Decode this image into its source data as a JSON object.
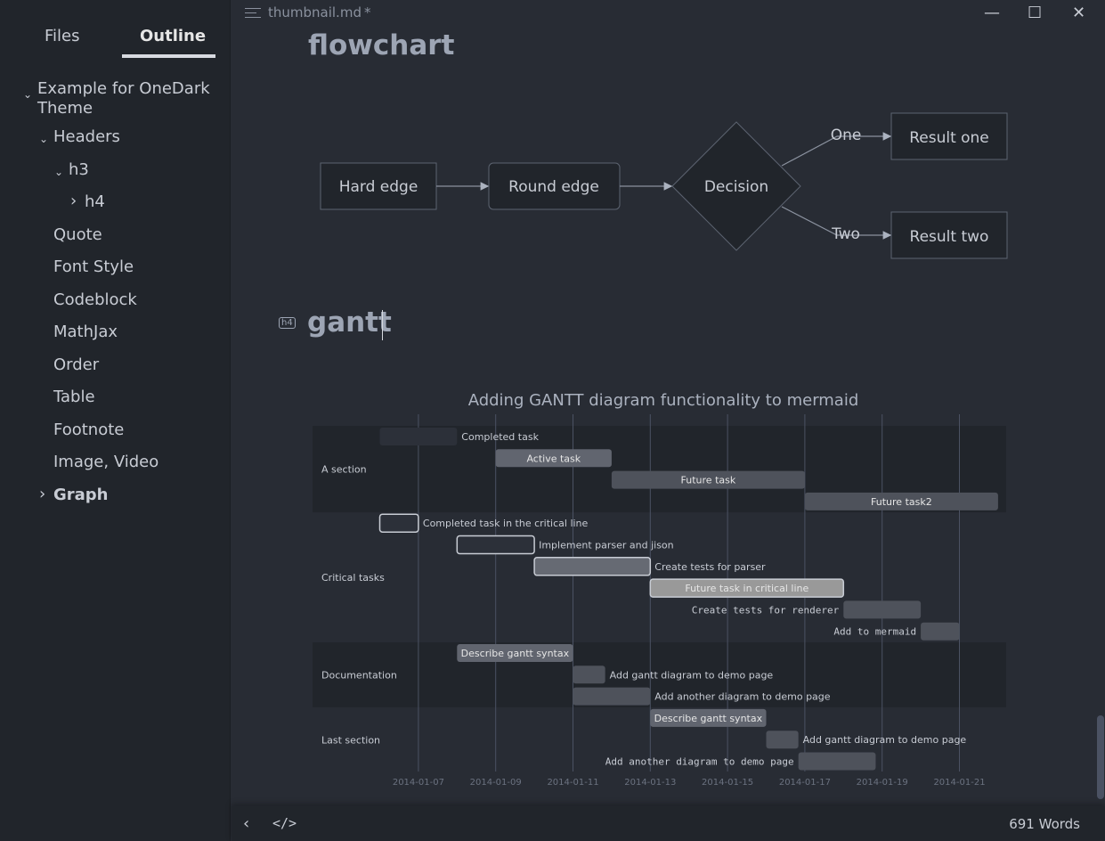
{
  "sidebar": {
    "tabs": [
      "Files",
      "Outline"
    ],
    "active_tab": "Outline",
    "outline": [
      {
        "label": "Example for OneDark Theme",
        "level": 0,
        "chevron": "down"
      },
      {
        "label": "Headers",
        "level": 1,
        "chevron": "down"
      },
      {
        "label": "h3",
        "level": 2,
        "chevron": "down"
      },
      {
        "label": "h4",
        "level": 3,
        "chevron": "right"
      },
      {
        "label": "Quote",
        "level": 1
      },
      {
        "label": "Font Style",
        "level": 1
      },
      {
        "label": "Codeblock",
        "level": 1
      },
      {
        "label": "MathJax",
        "level": 1
      },
      {
        "label": "Order",
        "level": 1
      },
      {
        "label": "Table",
        "level": 1
      },
      {
        "label": "Footnote",
        "level": 1
      },
      {
        "label": "Image, Video",
        "level": 1
      },
      {
        "label": "Graph",
        "level": 1,
        "chevron": "right",
        "bold": true
      }
    ]
  },
  "titlebar": {
    "filename": "thumbnail.md",
    "modified": "*",
    "minimize": "—",
    "maximize": "☐",
    "close": "✕"
  },
  "headings": {
    "flowchart": "flowchart",
    "gantt": "gantt",
    "gantt_badge": "h4"
  },
  "flowchart": {
    "nodes": {
      "a": "Hard edge",
      "b": "Round edge",
      "c": "Decision",
      "d": "Result one",
      "e": "Result two"
    },
    "edges": {
      "one": "One",
      "two": "Two"
    }
  },
  "chart_data": {
    "type": "gantt",
    "title": "Adding GANTT diagram functionality to mermaid",
    "xlim": [
      "2014-01-06",
      "2014-01-23"
    ],
    "ticks": [
      "2014-01-07",
      "2014-01-09",
      "2014-01-11",
      "2014-01-13",
      "2014-01-15",
      "2014-01-17",
      "2014-01-19",
      "2014-01-21"
    ],
    "sections": [
      {
        "name": "A section",
        "tasks": [
          {
            "name": "Completed task",
            "start": "2014-01-06",
            "days": 2,
            "status": "done"
          },
          {
            "name": "Active task",
            "start": "2014-01-09",
            "days": 3,
            "status": "active"
          },
          {
            "name": "Future task",
            "start": "2014-01-12",
            "days": 5,
            "status": "future"
          },
          {
            "name": "Future task2",
            "start": "2014-01-17",
            "days": 5,
            "status": "future"
          }
        ]
      },
      {
        "name": "Critical tasks",
        "tasks": [
          {
            "name": "Completed task in the critical line",
            "start": "2014-01-06",
            "days": 1,
            "status": "done",
            "crit": true
          },
          {
            "name": "Implement parser and jison",
            "start": "2014-01-08",
            "days": 2,
            "status": "done",
            "crit": true
          },
          {
            "name": "Create tests for parser",
            "start": "2014-01-10",
            "days": 3,
            "status": "active",
            "crit": true
          },
          {
            "name": "Future task in critical line",
            "start": "2014-01-13",
            "days": 5,
            "status": "future",
            "crit": true
          },
          {
            "name": "Create tests for renderer",
            "start": "2014-01-18",
            "days": 2,
            "status": "future"
          },
          {
            "name": "Add to mermaid",
            "start": "2014-01-20",
            "days": 1,
            "status": "future"
          }
        ]
      },
      {
        "name": "Documentation",
        "tasks": [
          {
            "name": "Describe gantt syntax",
            "start": "2014-01-08",
            "days": 3,
            "status": "active"
          },
          {
            "name": "Add gantt diagram to demo page",
            "start": "2014-01-11",
            "days": 0.833,
            "status": "future"
          },
          {
            "name": "Add another diagram to demo page",
            "start": "2014-01-11",
            "days": 2,
            "status": "future"
          }
        ]
      },
      {
        "name": "Last section",
        "tasks": [
          {
            "name": "Describe gantt syntax",
            "start": "2014-01-13",
            "days": 3,
            "status": "active"
          },
          {
            "name": "Add gantt diagram to demo page",
            "start": "2014-01-16",
            "days": 0.833,
            "status": "future"
          },
          {
            "name": "Add another diagram to demo page",
            "start": "2014-01-16.833",
            "days": 2,
            "status": "future"
          }
        ]
      }
    ]
  },
  "status": {
    "word_count": "691 Words",
    "back": "‹",
    "source": "</>"
  }
}
